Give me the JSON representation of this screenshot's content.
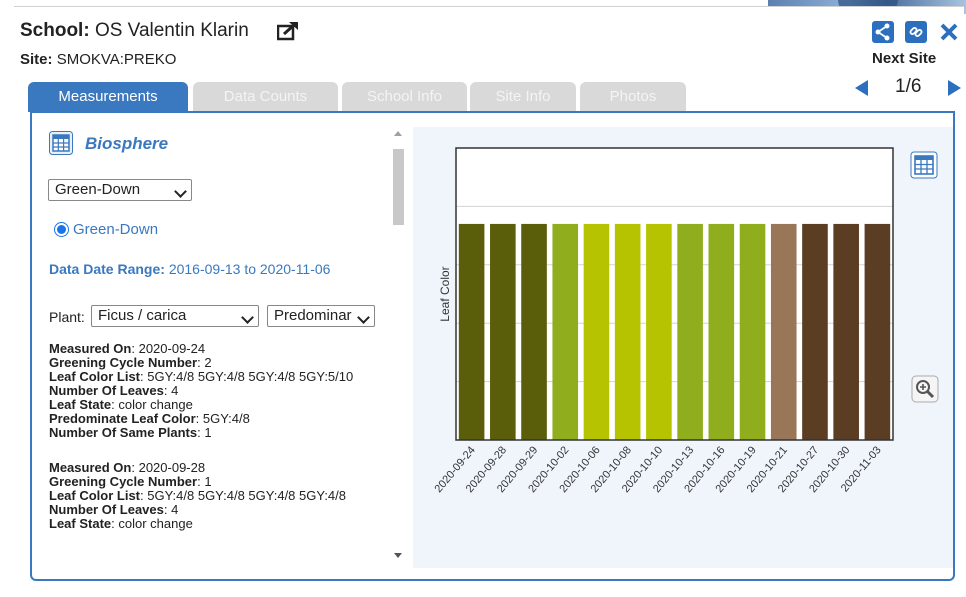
{
  "header": {
    "school_label": "School:",
    "school_name": "OS Valentin Klarin",
    "site_label": "Site:",
    "site_name": "SMOKVA:PREKO"
  },
  "nav": {
    "next_site_label": "Next Site",
    "page_indicator": "1/6"
  },
  "tabs": [
    {
      "label": "Measurements",
      "active": true
    },
    {
      "label": "Data Counts",
      "active": false
    },
    {
      "label": "School Info",
      "active": false
    },
    {
      "label": "Site Info",
      "active": false
    },
    {
      "label": "Photos",
      "active": false
    }
  ],
  "left": {
    "section_title": "Biosphere",
    "protocol_select_value": "Green-Down",
    "radio_label": "Green-Down",
    "date_range_label": "Data Date Range:",
    "date_range_value": "2016-09-13 to 2020-11-06",
    "plant_label": "Plant:",
    "plant_select_value": "Ficus / carica",
    "color_select_value": "Predominar"
  },
  "records": [
    {
      "measured_on_label": "Measured On",
      "measured_on": "2020-09-24",
      "cycle_label": "Greening Cycle Number",
      "cycle": "2",
      "color_list_label": "Leaf Color List",
      "color_list": "5GY:4/8 5GY:4/8 5GY:4/8 5GY:5/10",
      "leaves_label": "Number Of Leaves",
      "leaves": "4",
      "state_label": "Leaf State",
      "state": "color change",
      "predominate_label": "Predominate Leaf Color",
      "predominate": "5GY:4/8",
      "same_plants_label": "Number Of Same Plants",
      "same_plants": "1"
    },
    {
      "measured_on_label": "Measured On",
      "measured_on": "2020-09-28",
      "cycle_label": "Greening Cycle Number",
      "cycle": "1",
      "color_list_label": "Leaf Color List",
      "color_list": "5GY:4/8 5GY:4/8 5GY:4/8 5GY:4/8",
      "leaves_label": "Number Of Leaves",
      "leaves": "4",
      "state_label": "Leaf State",
      "state": "color change"
    }
  ],
  "colors": {
    "accent": "#3a78bf",
    "tab_inactive": "#d9d9d9",
    "chart_bg": "#f0f5fc"
  },
  "icons": {
    "external": "external-link-icon",
    "share": "share-icon",
    "link": "link-icon",
    "close": "close-icon",
    "table": "table-icon",
    "zoom": "zoom-in-icon"
  },
  "chart_data": {
    "type": "bar",
    "ylabel": "Leaf Color",
    "xlabel": "",
    "title": "",
    "grid": true,
    "ylim": [
      0,
      1
    ],
    "categories": [
      "2020-09-24",
      "2020-09-28",
      "2020-09-29",
      "2020-10-02",
      "2020-10-06",
      "2020-10-08",
      "2020-10-10",
      "2020-10-13",
      "2020-10-16",
      "2020-10-19",
      "2020-10-21",
      "2020-10-27",
      "2020-10-30",
      "2020-11-03"
    ],
    "values": [
      0.74,
      0.74,
      0.74,
      0.74,
      0.74,
      0.74,
      0.74,
      0.74,
      0.74,
      0.74,
      0.74,
      0.74,
      0.74,
      0.74
    ],
    "bar_colors": [
      "#5a5e0a",
      "#5a5e0a",
      "#5a5e0a",
      "#8fad1c",
      "#b5c300",
      "#b5c300",
      "#b5c300",
      "#8fad1c",
      "#8fad1c",
      "#8fad1c",
      "#9a7658",
      "#5a3d23",
      "#5a3d23",
      "#5a3d23"
    ]
  }
}
